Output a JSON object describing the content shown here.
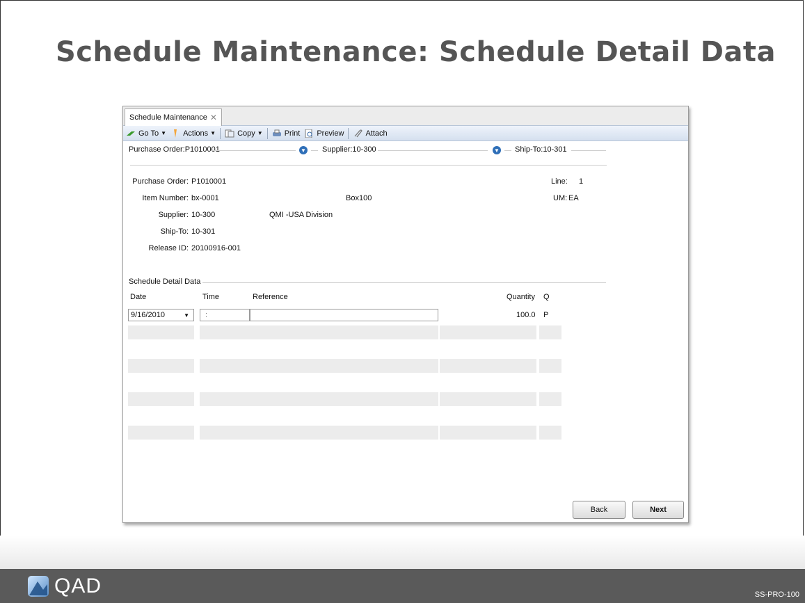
{
  "slide": {
    "title": "Schedule Maintenance: Schedule Detail Data",
    "logo_text": "QAD",
    "code": "SS-PRO-100"
  },
  "window": {
    "tab_label": "Schedule Maintenance",
    "tab_close": "✕",
    "toolbar": {
      "goto": "Go To",
      "actions": "Actions",
      "copy": "Copy",
      "print": "Print",
      "preview": "Preview",
      "attach": "Attach"
    },
    "header_sections": {
      "purchase_order": "Purchase Order:P1010001",
      "supplier": "Supplier:10-300",
      "ship_to": "Ship-To:10-301"
    },
    "detail": {
      "purchase_order_label": "Purchase Order:",
      "purchase_order_value": "P1010001",
      "item_number_label": "Item Number:",
      "item_number_value": "bx-0001",
      "item_description": "Box100",
      "supplier_label": "Supplier:",
      "supplier_value": "10-300",
      "supplier_name": "QMI -USA Division",
      "ship_to_label": "Ship-To:",
      "ship_to_value": "10-301",
      "release_id_label": "Release ID:",
      "release_id_value": "20100916-001",
      "line_label": "Line:",
      "line_value": "1",
      "um_label": "UM:",
      "um_value": "EA"
    },
    "schedule": {
      "section_title": "Schedule Detail Data",
      "columns": [
        "Date",
        "Time",
        "Reference",
        "Quantity",
        "Q"
      ],
      "row": {
        "date": "9/16/2010",
        "time": ":",
        "reference": "",
        "quantity": "100.0",
        "q": "P"
      }
    },
    "buttons": {
      "back": "Back",
      "next": "Next"
    }
  },
  "colors": {
    "title": "#555555",
    "footer": "#5a5a5a",
    "toolbar": "#d5e0ef",
    "accent": "#2f6fb8"
  }
}
